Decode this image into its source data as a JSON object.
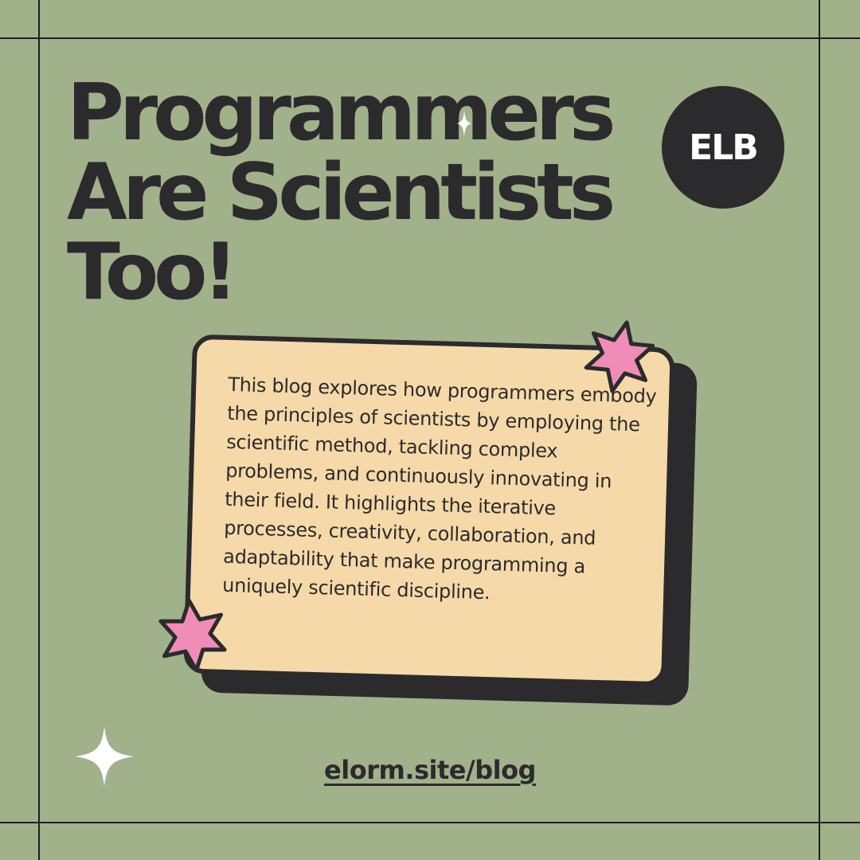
{
  "title": {
    "line1": "Programmers",
    "line2": "Are Scientists",
    "line3": "Too!"
  },
  "badge": {
    "text": "ELB"
  },
  "card": {
    "description": "This blog explores how programmers embody the principles of scientists by employing the scientific method, tackling complex problems, and continuously innovating in their field. It highlights the iterative processes, creativity, collaboration, and adaptability that make programming a uniquely scientific discipline."
  },
  "footer": {
    "url": "elorm.site/blog"
  },
  "colors": {
    "background": "#a1b18a",
    "dark": "#2b2b2d",
    "card": "#f5d9a8",
    "star": "#f08db6",
    "sparkle": "#ffffff"
  },
  "icons": [
    "star-icon",
    "sparkle-icon"
  ]
}
